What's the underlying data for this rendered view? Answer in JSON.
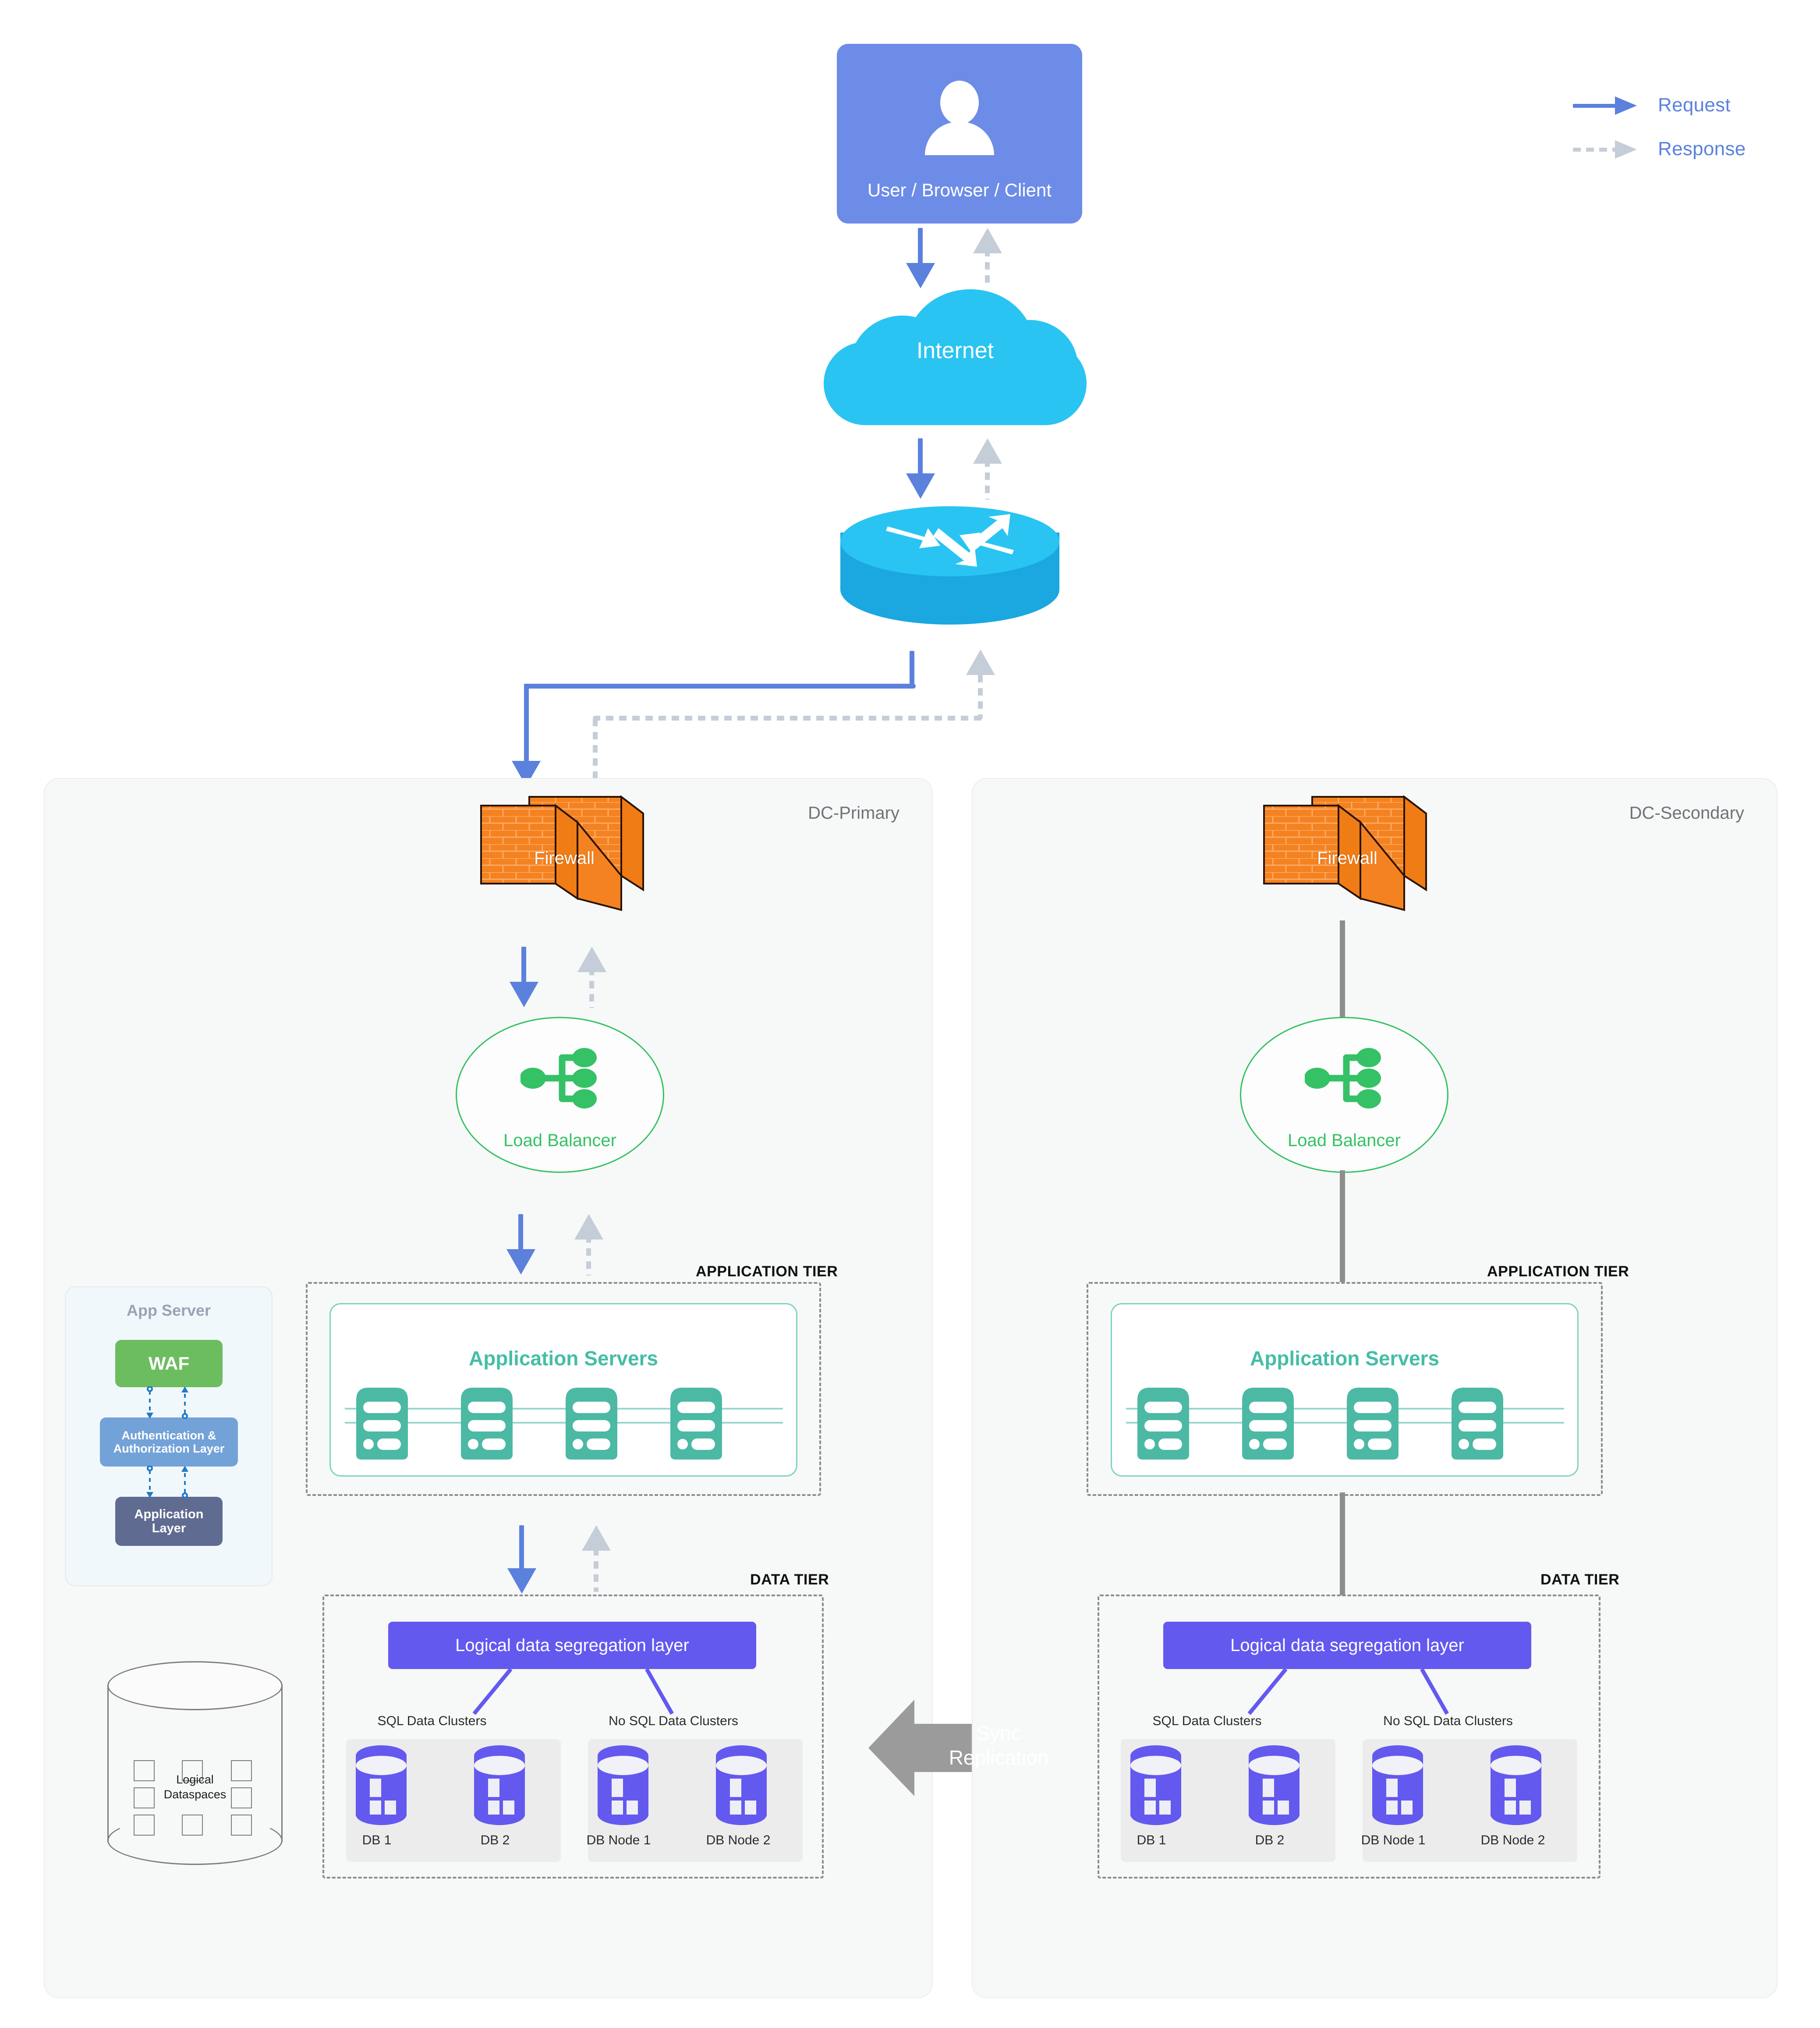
{
  "legend": {
    "items": [
      {
        "label": "Request",
        "style": "solid",
        "color": "#5b81dd"
      },
      {
        "label": "Response",
        "style": "dashed",
        "color": "#c5cdd8"
      }
    ]
  },
  "client": {
    "label": "User / Browser / Client",
    "icon": "user-icon",
    "color": "#6d8ce8"
  },
  "internet": {
    "label": "Internet",
    "icon": "cloud-icon",
    "color": "#29c4f2"
  },
  "router": {
    "label": "Router",
    "icon": "router-icon",
    "color": "#29c4f2"
  },
  "app_server_panel": {
    "title": "App Server",
    "layers": [
      {
        "label": "WAF",
        "color": "#6cbd5f"
      },
      {
        "label": "Authentication &\nAuthorization Layer",
        "color": "#73a2d8"
      },
      {
        "label": "Application\nLayer",
        "color": "#5f6b91"
      }
    ]
  },
  "dataspaces": {
    "label": "Logical\nDataspaces",
    "icon": "database-cylinder-icon"
  },
  "sync": {
    "label": "Sync\nReplication",
    "color": "#9b9b9b"
  },
  "datacenters": [
    {
      "id": "dc-primary",
      "title": "DC-Primary",
      "firewall": {
        "label": "Firewall",
        "color": "#f58220"
      },
      "load_balancer": {
        "label": "Load Balancer",
        "color": "#35c165"
      },
      "application_tier": {
        "tier_label": "APPLICATION TIER",
        "card_title": "Application Servers",
        "server_count": 4,
        "color": "#45bda6"
      },
      "data_tier": {
        "tier_label": "DATA TIER",
        "segregation_layer": "Logical data segregation layer",
        "clusters": [
          {
            "name": "SQL Data Clusters",
            "nodes": [
              "DB 1",
              "DB 2"
            ]
          },
          {
            "name": "No SQL Data Clusters",
            "nodes": [
              "DB Node 1",
              "DB Node 2"
            ]
          }
        ]
      }
    },
    {
      "id": "dc-secondary",
      "title": "DC-Secondary",
      "firewall": {
        "label": "Firewall",
        "color": "#f58220"
      },
      "load_balancer": {
        "label": "Load Balancer",
        "color": "#35c165"
      },
      "application_tier": {
        "tier_label": "APPLICATION TIER",
        "card_title": "Application Servers",
        "server_count": 4,
        "color": "#45bda6"
      },
      "data_tier": {
        "tier_label": "DATA TIER",
        "segregation_layer": "Logical data segregation layer",
        "clusters": [
          {
            "name": "SQL Data Clusters",
            "nodes": [
              "DB 1",
              "DB 2"
            ]
          },
          {
            "name": "No SQL Data Clusters",
            "nodes": [
              "DB Node 1",
              "DB Node 2"
            ]
          }
        ]
      }
    }
  ]
}
